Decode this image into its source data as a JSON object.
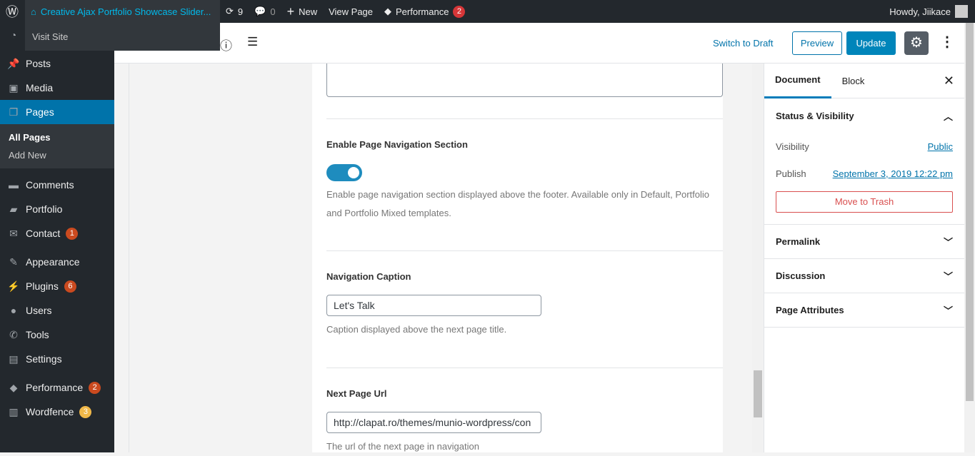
{
  "adminbar": {
    "site": "Creative Ajax Portfolio Showcase Slider...",
    "visit": "Visit Site",
    "updates": "9",
    "comments": "0",
    "new": "New",
    "view": "View Page",
    "performance": "Performance",
    "perf_count": "2",
    "howdy": "Howdy, Jiikace"
  },
  "sidebar": {
    "items": [
      {
        "label": "Posts",
        "icon": "pin-icon"
      },
      {
        "label": "Media",
        "icon": "media-icon"
      },
      {
        "label": "Pages",
        "icon": "pages-icon"
      },
      {
        "label": "Comments",
        "icon": "comment-icon"
      },
      {
        "label": "Portfolio",
        "icon": "folder-icon"
      },
      {
        "label": "Contact",
        "icon": "mail-icon",
        "badge": "1"
      },
      {
        "label": "Appearance",
        "icon": "brush-icon"
      },
      {
        "label": "Plugins",
        "icon": "plug-icon",
        "badge": "6"
      },
      {
        "label": "Users",
        "icon": "user-icon"
      },
      {
        "label": "Tools",
        "icon": "wrench-icon"
      },
      {
        "label": "Settings",
        "icon": "settings-icon"
      },
      {
        "label": "Performance",
        "icon": "cube-icon",
        "badge": "2"
      },
      {
        "label": "Wordfence",
        "icon": "wordfence-icon",
        "badge": "3"
      }
    ],
    "sub": [
      "All Pages",
      "Add New"
    ]
  },
  "toolbar": {
    "switch": "Switch to Draft",
    "preview": "Preview",
    "update": "Update"
  },
  "editor": {
    "nav_label": "Enable Page Navigation Section",
    "nav_enabled": true,
    "nav_help": "Enable page navigation section displayed above the footer. Available only in Default, Portfolio and Portfolio Mixed templates.",
    "caption_label": "Navigation Caption",
    "caption_value": "Let's Talk",
    "caption_help": "Caption displayed above the next page title.",
    "url_label": "Next Page Url",
    "url_value": "http://clapat.ro/themes/munio-wordpress/con",
    "url_help": "The url of the next page in navigation"
  },
  "settings": {
    "tabs": [
      "Document",
      "Block"
    ],
    "status": "Status & Visibility",
    "visibility_label": "Visibility",
    "visibility": "Public",
    "publish_label": "Publish",
    "publish": "September 3, 2019 12:22 pm",
    "trash": "Move to Trash",
    "sections": [
      "Permalink",
      "Discussion",
      "Page Attributes"
    ]
  },
  "colors": {
    "accent": "#0073aa",
    "toggle": "#1e8cbe"
  }
}
